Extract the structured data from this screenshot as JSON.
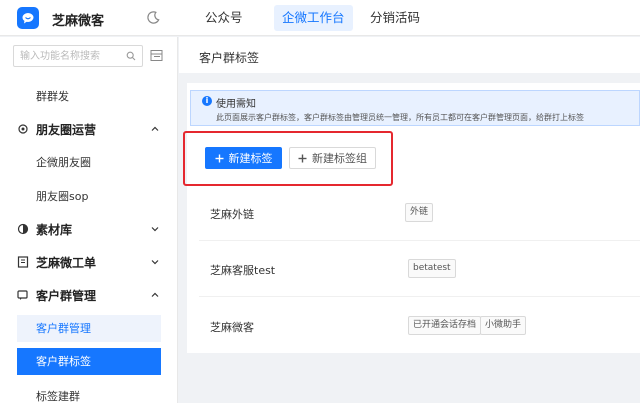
{
  "app": {
    "title": "芝麻微客"
  },
  "nav": {
    "tabs": [
      {
        "label": "公众号"
      },
      {
        "label": "企微工作台"
      },
      {
        "label": "分销活码"
      }
    ]
  },
  "sidebar": {
    "search_placeholder": "输入功能名称搜索",
    "items": {
      "qunfa": "群群发",
      "moments_group": "朋友圈运营",
      "qiwei_moments": "企微朋友圈",
      "moments_sop": "朋友圈sop",
      "materials": "素材库",
      "work_order": "芝麻微工单",
      "group_mgmt": "客户群管理",
      "group_mgmt_sub": "客户群管理",
      "group_tags": "客户群标签",
      "tag_build": "标签建群"
    }
  },
  "main": {
    "page_title": "客户群标签",
    "notice": {
      "title": "使用需知",
      "body": "此页面展示客户群标签，客户群标签由管理员统一管理，所有员工都可在客户群管理页面，给群打上标签"
    },
    "buttons": {
      "new_tag": "新建标签",
      "new_tag_group": "新建标签组"
    },
    "tag_groups": [
      {
        "name": "芝麻外链",
        "tags": [
          "外链"
        ]
      },
      {
        "name": "芝麻客服test",
        "tags": [
          "betatest"
        ]
      },
      {
        "name": "芝麻微客",
        "tags": [
          "已开通会话存档",
          "小微助手"
        ]
      }
    ]
  },
  "colors": {
    "accent": "#1677ff",
    "highlight_frame": "#e5282f"
  }
}
